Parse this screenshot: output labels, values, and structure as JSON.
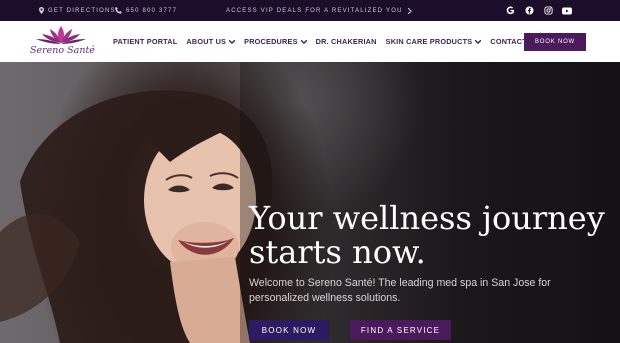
{
  "topbar": {
    "directions": "GET DIRECTIONS",
    "phone": "650 800 3777",
    "promo": "ACCESS VIP DEALS FOR A REVITALIZED YOU",
    "social_icons": [
      "google-icon",
      "facebook-icon",
      "instagram-icon",
      "youtube-icon"
    ]
  },
  "header": {
    "logo_text": "Sereno Santé",
    "nav": [
      {
        "label": "PATIENT PORTAL",
        "dropdown": false
      },
      {
        "label": "ABOUT US",
        "dropdown": true
      },
      {
        "label": "PROCEDURES",
        "dropdown": true
      },
      {
        "label": "DR. CHAKERIAN",
        "dropdown": false
      },
      {
        "label": "SKIN CARE PRODUCTS",
        "dropdown": true
      },
      {
        "label": "CONTACT",
        "dropdown": false
      }
    ],
    "book_label": "BOOK NOW"
  },
  "hero": {
    "title_line1": "Your wellness journey",
    "title_line2": "starts now.",
    "subtitle": "Welcome to Sereno Santé! The leading med spa in San Jose for personalized wellness solutions.",
    "book_label": "BOOK NOW",
    "find_label": "FIND A SERVICE"
  },
  "colors": {
    "topbar_bg": "#1c0e2b",
    "brand_purple": "#4a1a5c",
    "nav_text": "#3b1f59",
    "book_button": "#2c1a62"
  }
}
